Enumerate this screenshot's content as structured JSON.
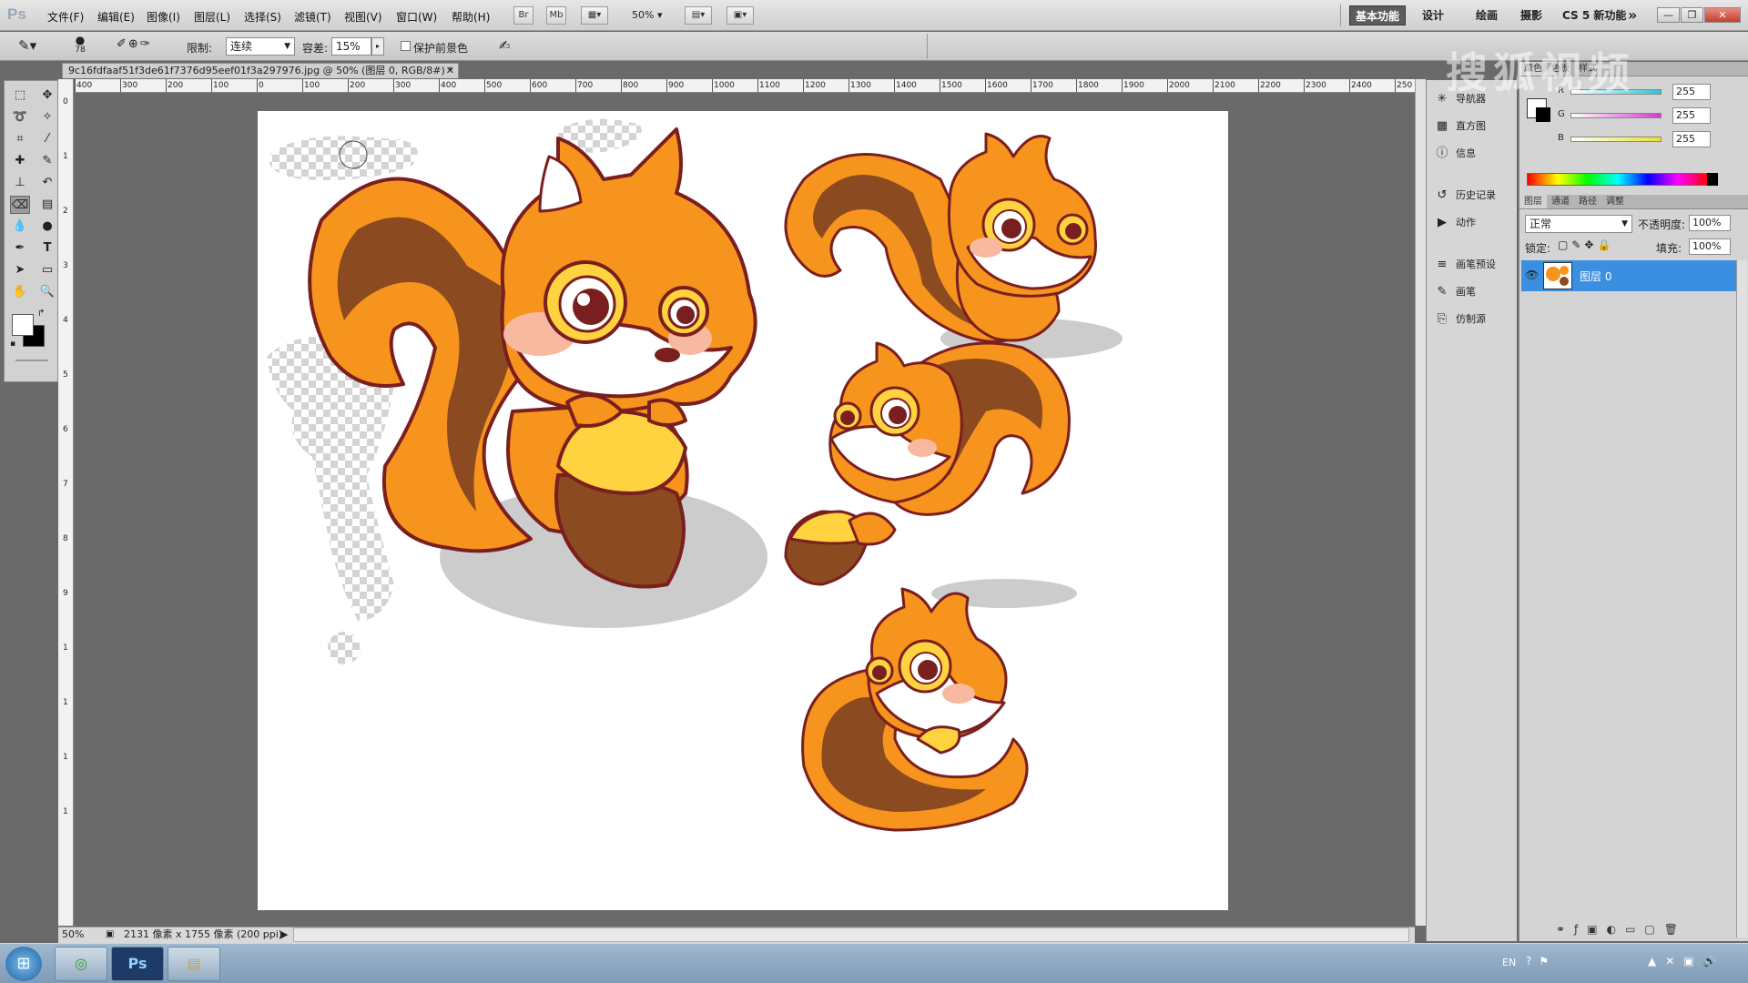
{
  "app": {
    "logo": "Ps"
  },
  "menu": [
    "文件(F)",
    "编辑(E)",
    "图像(I)",
    "图层(L)",
    "选择(S)",
    "滤镜(T)",
    "视图(V)",
    "窗口(W)",
    "帮助(H)"
  ],
  "appbar": {
    "br": "Br",
    "mb": "Mb",
    "zoom": "50%"
  },
  "workspaces": [
    "基本功能",
    "设计",
    "绘画",
    "摄影",
    "CS 5 新功能"
  ],
  "window_controls": {
    "minimize": "—",
    "restore": "❐",
    "close": "✕"
  },
  "options": {
    "brush_size": "78",
    "limit_label": "限制:",
    "limit_value": "连续",
    "tolerance_label": "容差:",
    "tolerance_value": "15%",
    "protect_label": "保护前景色"
  },
  "document": {
    "tab_title": "9c16fdfaaf51f3de61f7376d95eef01f3a297976.jpg @ 50% (图层 0, RGB/8#) *",
    "close": "✕"
  },
  "ruler_h": [
    "400",
    "300",
    "200",
    "100",
    "0",
    "100",
    "200",
    "300",
    "400",
    "500",
    "600",
    "700",
    "800",
    "900",
    "1000",
    "1100",
    "1200",
    "1300",
    "1400",
    "1500",
    "1600",
    "1700",
    "1800",
    "1900",
    "2000",
    "2100",
    "2200",
    "2300",
    "2400",
    "250"
  ],
  "ruler_v": [
    "0",
    "1",
    "2",
    "3",
    "4",
    "5",
    "6",
    "7",
    "8",
    "9",
    "1",
    "1",
    "1",
    "1"
  ],
  "status": {
    "zoom": "50%",
    "info": "2131 像素 x 1755 像素 (200 ppi)"
  },
  "side_panels": [
    {
      "icon": "navigator-icon",
      "glyph": "✳",
      "label": "导航器"
    },
    {
      "icon": "histogram-icon",
      "glyph": "▦",
      "label": "直方图"
    },
    {
      "icon": "info-icon",
      "glyph": "ⓘ",
      "label": "信息"
    },
    {
      "icon": "history-icon",
      "glyph": "↺",
      "label": "历史记录"
    },
    {
      "icon": "actions-icon",
      "glyph": "▶",
      "label": "动作"
    },
    {
      "icon": "brush-presets-icon",
      "glyph": "≡",
      "label": "画笔预设"
    },
    {
      "icon": "brush-icon",
      "glyph": "✎",
      "label": "画笔"
    },
    {
      "icon": "clone-source-icon",
      "glyph": "⎘",
      "label": "仿制源"
    }
  ],
  "color_panel": {
    "tabs": [
      "颜色",
      "色板",
      "样式"
    ],
    "channels": [
      {
        "label": "R",
        "value": "255",
        "color": "#29c6d9"
      },
      {
        "label": "G",
        "value": "255",
        "color": "#d13bd1"
      },
      {
        "label": "B",
        "value": "255",
        "color": "#e6e12c"
      }
    ]
  },
  "layers_panel": {
    "tabs": [
      "图层",
      "通道",
      "路径",
      "调整"
    ],
    "blend_mode": "正常",
    "opacity_label": "不透明度:",
    "opacity_value": "100%",
    "lock_label": "锁定:",
    "fill_label": "填充:",
    "fill_value": "100%",
    "layer_name": "图层 0"
  },
  "watermark": "搜狐视频",
  "taskbar": {
    "start": "⊞",
    "apps": [
      "◎",
      "Ps",
      "▤"
    ],
    "tray": "EN"
  },
  "colors": {
    "squirrel_orange": "#f7941d",
    "squirrel_brown": "#8b4a1f",
    "outline": "#7a1f1f",
    "acorn_yellow": "#ffd23f",
    "selected_layer": "#3b8fe0"
  }
}
